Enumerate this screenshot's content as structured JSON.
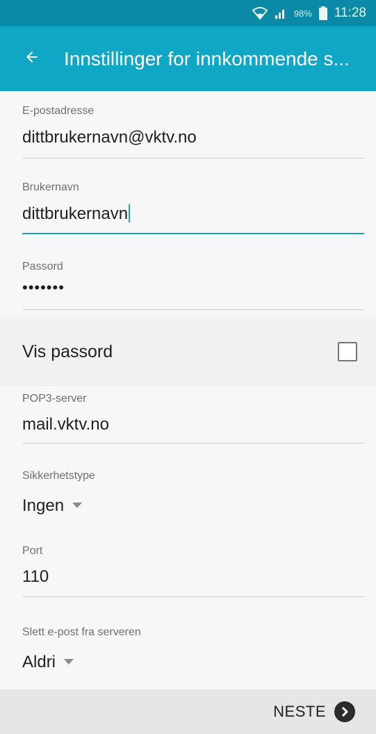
{
  "status_bar": {
    "battery": "98%",
    "time": "11:28",
    "icons": [
      "wifi-icon",
      "signal-icon",
      "battery-icon"
    ]
  },
  "app_bar": {
    "title": "Innstillinger for innkommende s...",
    "back_icon": "arrow-left-icon"
  },
  "fields": {
    "email": {
      "label": "E-postadresse",
      "value": "dittbrukernavn@vktv.no"
    },
    "username": {
      "label": "Brukernavn",
      "value": "dittbrukernavn"
    },
    "password": {
      "label": "Passord",
      "value": "•••••••"
    },
    "show_password": {
      "label": "Vis passord",
      "checked": false
    },
    "pop3_server": {
      "label": "POP3-server",
      "value": "mail.vktv.no"
    },
    "security_type": {
      "label": "Sikkerhetstype",
      "value": "Ingen"
    },
    "port": {
      "label": "Port",
      "value": "110"
    },
    "delete_from_server": {
      "label": "Slett e-post fra serveren",
      "value": "Aldri"
    }
  },
  "footer": {
    "next_label": "NESTE",
    "next_icon": "chevron-right-circle-icon"
  },
  "colors": {
    "status_bar": "#0a8aa6",
    "app_bar": "#10a7c6",
    "accent": "#10a7c6"
  }
}
